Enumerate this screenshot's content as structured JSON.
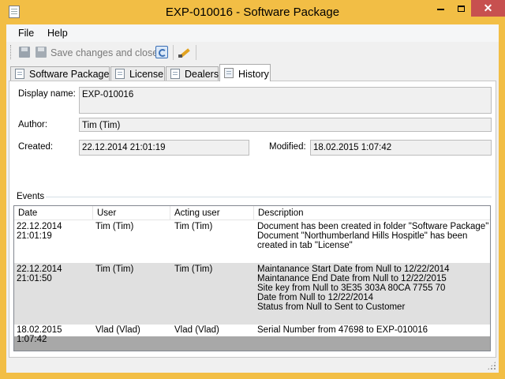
{
  "window": {
    "title": "EXP-010016 - Software Package"
  },
  "menu": {
    "items": [
      "File",
      "Help"
    ]
  },
  "toolbar": {
    "save_icon": "floppy-disk-icon",
    "save_and_close_label": "Save changes and close",
    "refresh_icon": "refresh-icon",
    "edit_icon": "edit-pencil-icon"
  },
  "tabs": [
    {
      "label": "Software Package",
      "active": false
    },
    {
      "label": "License",
      "active": false
    },
    {
      "label": "Dealers",
      "active": false
    },
    {
      "label": "History",
      "active": true
    }
  ],
  "form": {
    "display_name_label": "Display name:",
    "display_name_value": "EXP-010016",
    "author_label": "Author:",
    "author_value": "Tim (Tim)",
    "created_label": "Created:",
    "created_value": "22.12.2014 21:01:19",
    "modified_label": "Modified:",
    "modified_value": "18.02.2015 1:07:42"
  },
  "events": {
    "label": "Events",
    "columns": [
      "Date",
      "User",
      "Acting user",
      "Description"
    ],
    "rows": [
      {
        "date": "22.12.2014\n21:01:19",
        "user": "Tim (Tim)",
        "acting_user": "Tim (Tim)",
        "description": "Document has been created in folder \"Software Package\"\nDocument \"Northumberland Hills Hospitle\" has been created in tab \"License\"",
        "selected": false
      },
      {
        "date": "22.12.2014\n21:01:50",
        "user": "Tim (Tim)",
        "acting_user": "Tim (Tim)",
        "description": "Maintanance Start Date from Null to 12/22/2014\nMaintanance End Date from Null to 12/22/2015\nSite key from Null to 3E35 303A 80CA 7755 70\nDate from Null to 12/22/2014\nStatus from Null to Sent to Customer",
        "selected": true
      },
      {
        "date": "18.02.2015 1:07:42",
        "user": "Vlad (Vlad)",
        "acting_user": "Vlad (Vlad)",
        "description": "Serial Number from 47698 to EXP-010016",
        "selected": false
      }
    ]
  },
  "colors": {
    "titlebar": "#f2be45",
    "close_button": "#c7504f",
    "selected_row": "#e0e0e0",
    "grid_empty_area": "#a8a8a8"
  }
}
